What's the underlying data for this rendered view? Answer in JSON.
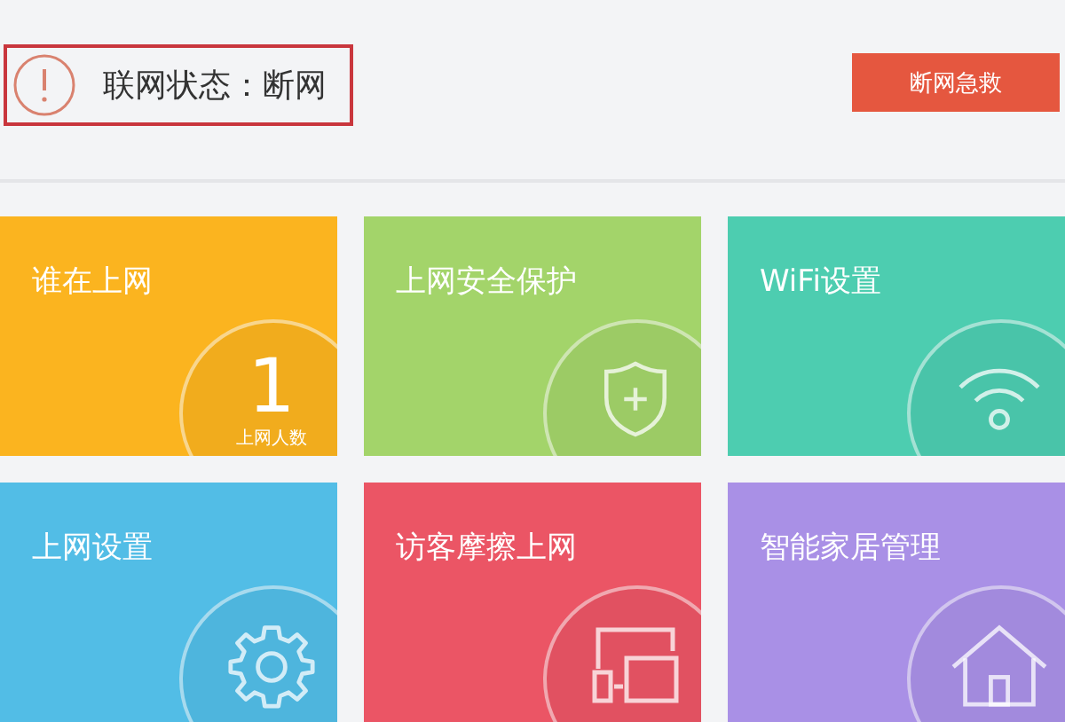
{
  "status": {
    "label": "联网状态：断网",
    "alert": true
  },
  "rescue_button": "断网急救",
  "tiles": [
    {
      "kind": "count",
      "title": "谁在上网",
      "color": "#fbb41f",
      "count": "1",
      "count_label": "上网人数"
    },
    {
      "kind": "icon",
      "title": "上网安全保护",
      "color": "#a3d46a"
    },
    {
      "kind": "icon",
      "title": "WiFi设置",
      "color": "#4dcdb0"
    },
    {
      "kind": "icon",
      "title": "上网设置",
      "color": "#52bde6"
    },
    {
      "kind": "icon",
      "title": "访客摩擦上网",
      "color": "#eb5565"
    },
    {
      "kind": "icon",
      "title": "智能家居管理",
      "color": "#a990e6"
    }
  ]
}
